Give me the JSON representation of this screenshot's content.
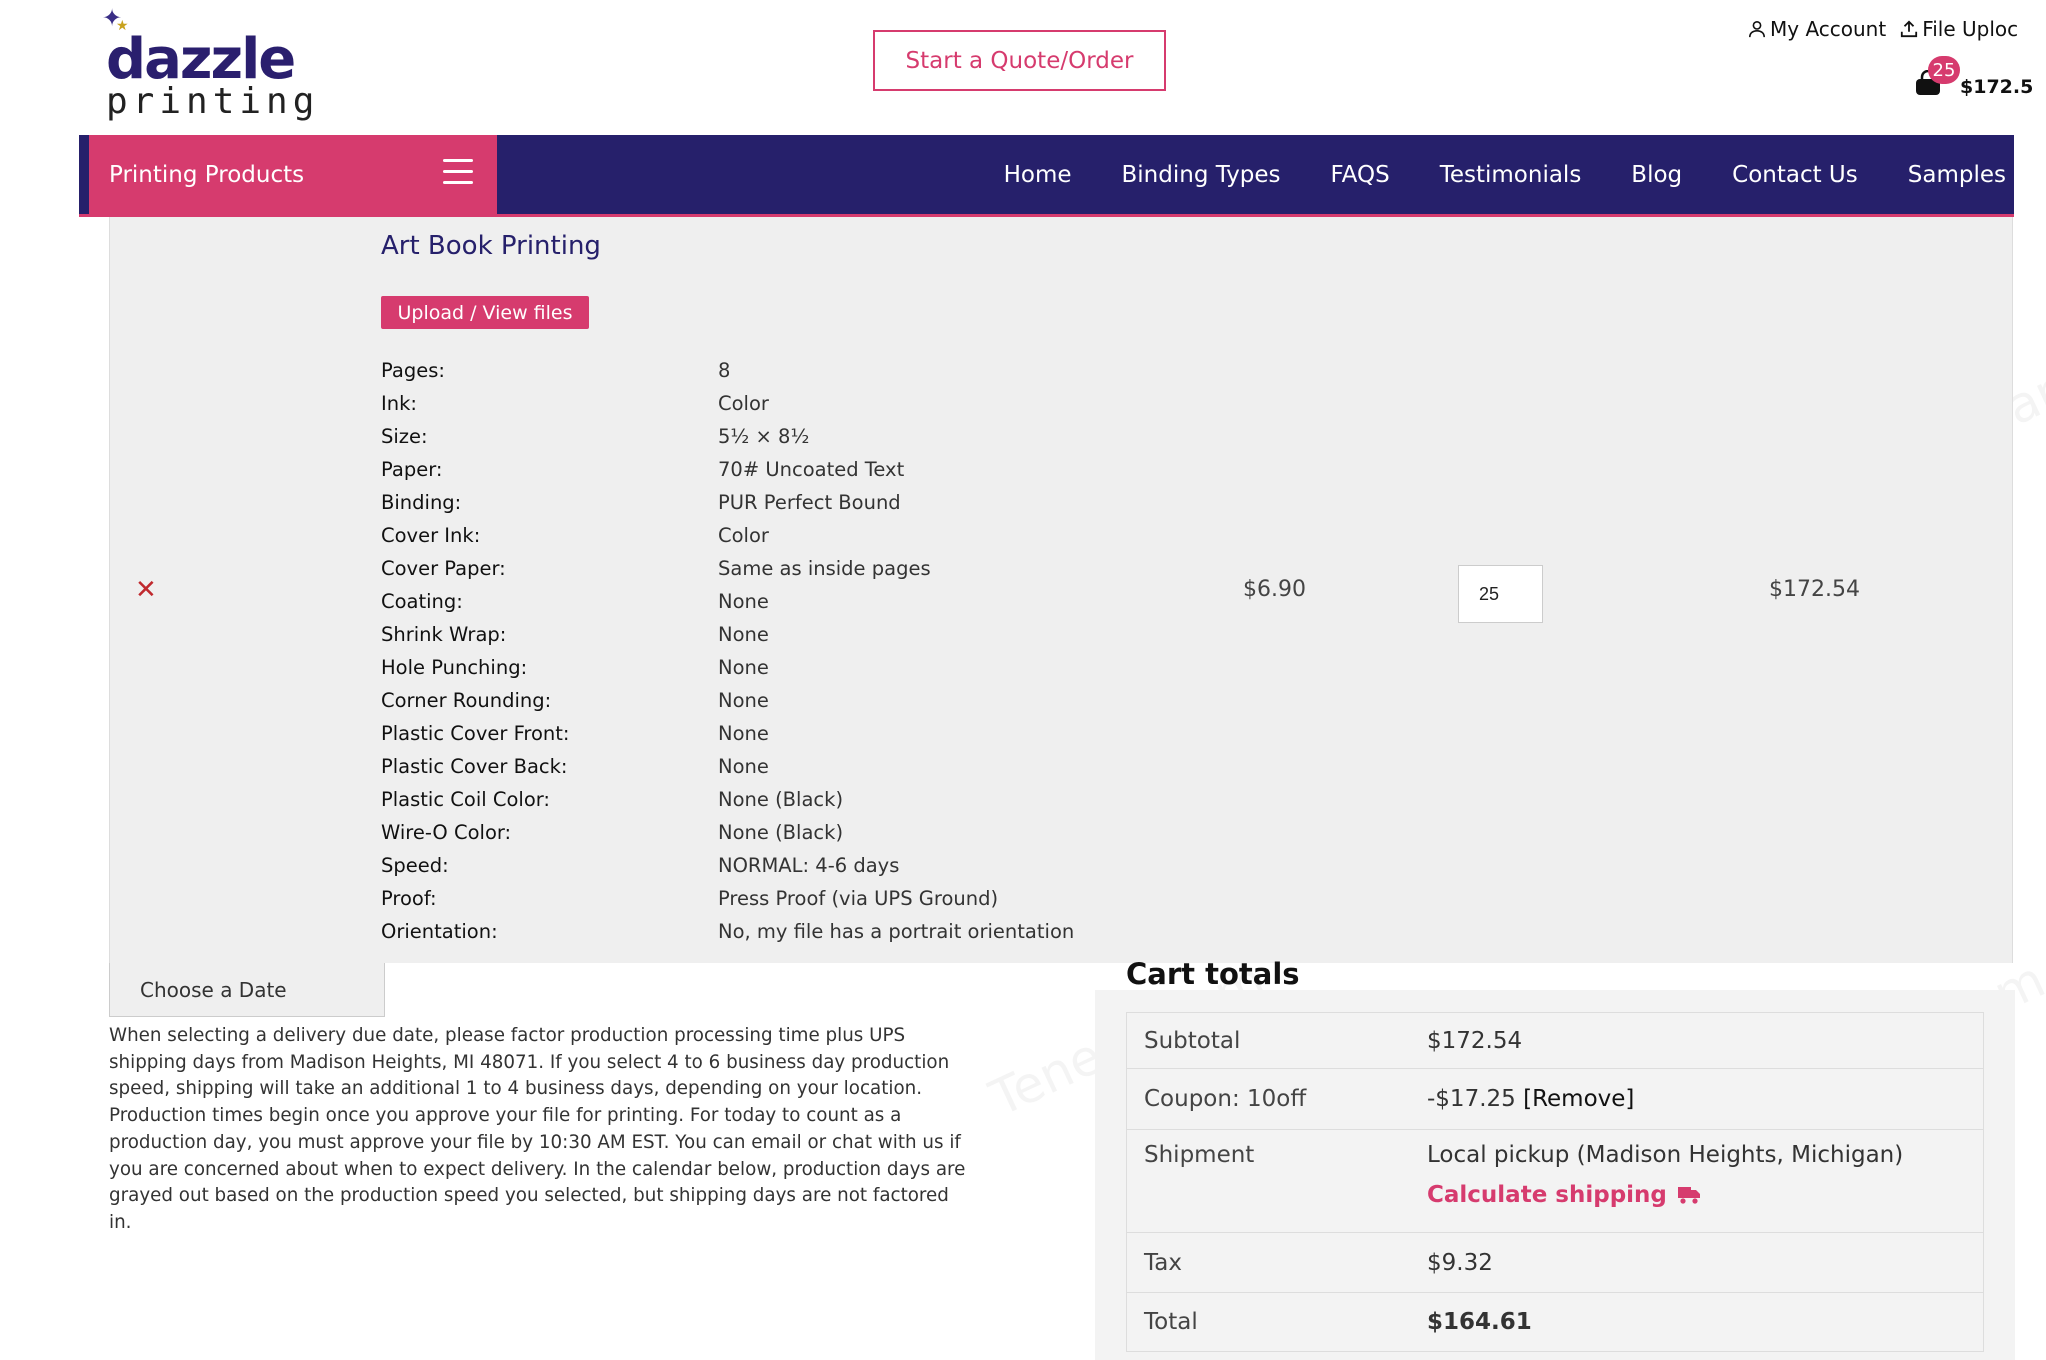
{
  "header": {
    "logo_top": "dazzle",
    "logo_bottom": "printing",
    "quote_button": "Start a Quote/Order",
    "my_account": "My Account",
    "file_upload": "File Uploc",
    "cart_count": "25",
    "cart_total": "$172.5"
  },
  "nav": {
    "products_label": "Printing Products",
    "items": [
      "Home",
      "Binding Types",
      "FAQS",
      "Testimonials",
      "Blog",
      "Contact Us",
      "Samples"
    ]
  },
  "item": {
    "title": "Art Book Printing",
    "upload_label": "Upload / View files",
    "specs": [
      {
        "k": "Pages:",
        "v": "8"
      },
      {
        "k": "Ink:",
        "v": "Color"
      },
      {
        "k": "Size:",
        "v": "5½ × 8½"
      },
      {
        "k": "Paper:",
        "v": "70# Uncoated Text"
      },
      {
        "k": "Binding:",
        "v": "PUR Perfect Bound"
      },
      {
        "k": "Cover Ink:",
        "v": "Color"
      },
      {
        "k": "Cover Paper:",
        "v": "Same as inside pages"
      },
      {
        "k": "Coating:",
        "v": "None"
      },
      {
        "k": "Shrink Wrap:",
        "v": "None"
      },
      {
        "k": "Hole Punching:",
        "v": "None"
      },
      {
        "k": "Corner Rounding:",
        "v": "None"
      },
      {
        "k": "Plastic Cover Front:",
        "v": "None"
      },
      {
        "k": "Plastic Cover Back:",
        "v": "None"
      },
      {
        "k": "Plastic Coil Color:",
        "v": "None (Black)"
      },
      {
        "k": "Wire-O Color:",
        "v": "None (Black)"
      },
      {
        "k": "Speed:",
        "v": "NORMAL: 4-6 days"
      },
      {
        "k": "Proof:",
        "v": "Press Proof (via UPS Ground)"
      },
      {
        "k": "Orientation:",
        "v": "No, my file has a portrait orientation"
      }
    ],
    "unit_price": "$6.90",
    "quantity": "25",
    "line_total": "$172.54"
  },
  "delivery": {
    "date_button": "Choose a Date",
    "info": "When selecting a delivery due date, please factor production processing time plus UPS shipping days from Madison Heights, MI 48071. If you select 4 to 6 business day production speed, shipping will take an additional 1 to 4 business days, depending on your location. Production times begin once you approve your file for printing. For today to count as a production day, you must approve your file by 10:30 AM EST. You can email or chat with us if you are concerned about when to expect delivery. In the calendar below, production days are grayed out based on the production speed you selected, but shipping days are not factored in."
  },
  "totals": {
    "title": "Cart totals",
    "subtotal_label": "Subtotal",
    "subtotal_value": "$172.54",
    "coupon_label": "Coupon: 10off",
    "coupon_value": "-$17.25",
    "coupon_remove": "[Remove]",
    "shipment_label": "Shipment",
    "shipment_value": "Local pickup (Madison Heights, Michigan)",
    "calc_shipping": "Calculate shipping",
    "tax_label": "Tax",
    "tax_value": "$9.32",
    "total_label": "Total",
    "total_value": "$164.61"
  },
  "colors": {
    "brand_navy": "#26206b",
    "brand_pink": "#d63b6e",
    "remove_red": "#c0292e"
  },
  "icons": [
    "user-icon",
    "upload-icon",
    "shopping-bag-icon",
    "hamburger-icon",
    "remove-icon",
    "truck-icon"
  ]
}
